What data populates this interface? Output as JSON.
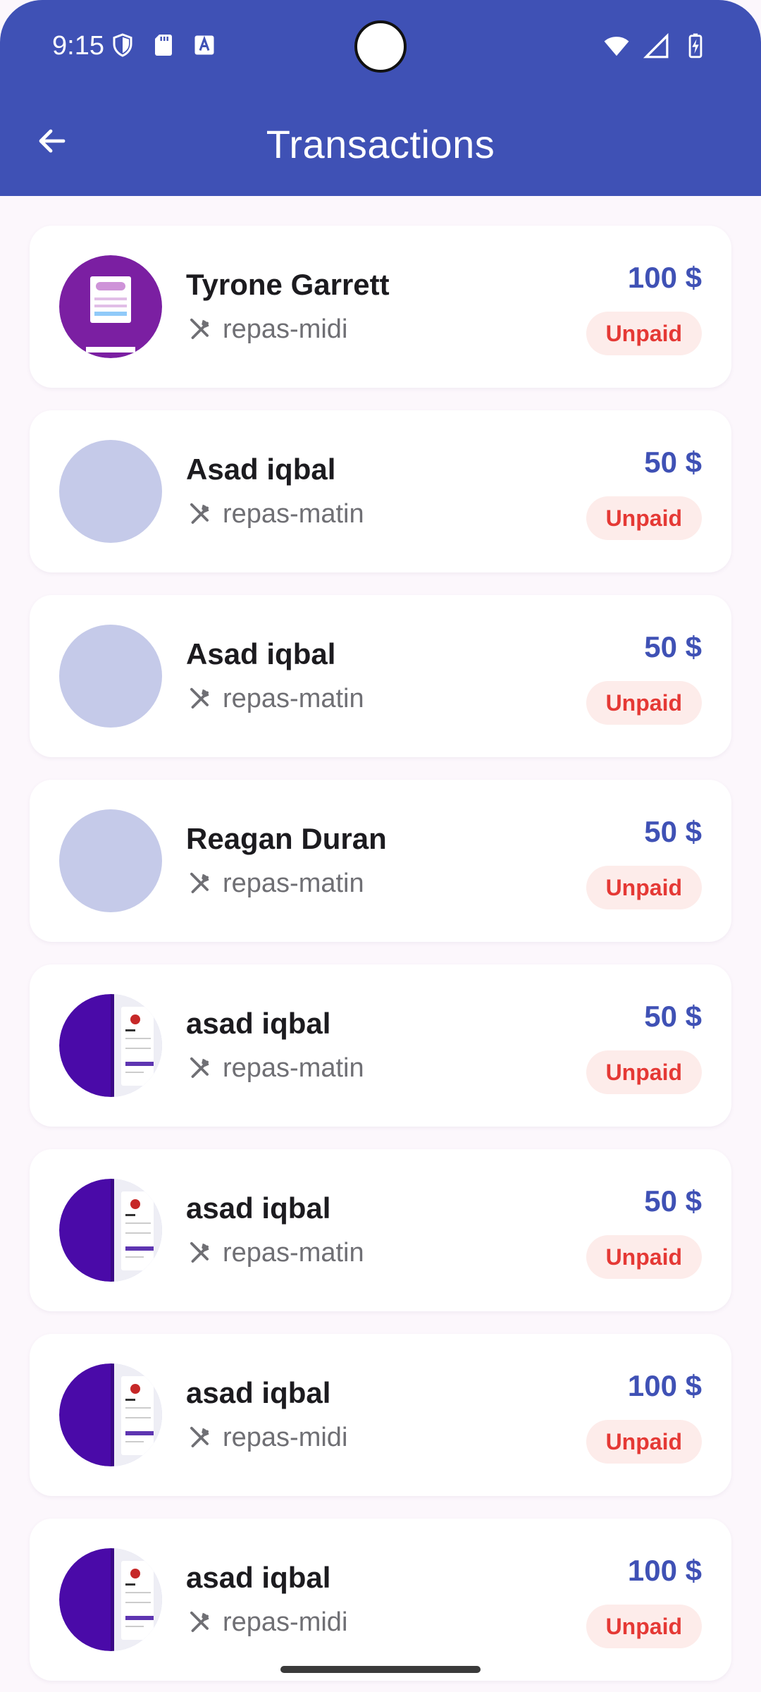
{
  "status_bar": {
    "time": "9:15"
  },
  "header": {
    "title": "Transactions"
  },
  "colors": {
    "primary": "#3f51b5",
    "unpaid_text": "#e53935",
    "unpaid_bg": "#fdecea",
    "avatar_placeholder": "#c5cae9"
  },
  "transactions": [
    {
      "name": "Tyrone Garrett",
      "meal": "repas-midi",
      "amount": "100 $",
      "status": "Unpaid",
      "avatar": "login-screenshot-purple"
    },
    {
      "name": "Asad iqbal",
      "meal": "repas-matin",
      "amount": "50 $",
      "status": "Unpaid",
      "avatar": "placeholder"
    },
    {
      "name": "Asad iqbal",
      "meal": "repas-matin",
      "amount": "50 $",
      "status": "Unpaid",
      "avatar": "placeholder"
    },
    {
      "name": "Reagan Duran",
      "meal": "repas-matin",
      "amount": "50 $",
      "status": "Unpaid",
      "avatar": "placeholder"
    },
    {
      "name": "asad iqbal",
      "meal": "repas-matin",
      "amount": "50 $",
      "status": "Unpaid",
      "avatar": "login-screenshot-split"
    },
    {
      "name": "asad iqbal",
      "meal": "repas-matin",
      "amount": "50 $",
      "status": "Unpaid",
      "avatar": "login-screenshot-split"
    },
    {
      "name": "asad iqbal",
      "meal": "repas-midi",
      "amount": "100 $",
      "status": "Unpaid",
      "avatar": "login-screenshot-split"
    },
    {
      "name": "asad iqbal",
      "meal": "repas-midi",
      "amount": "100 $",
      "status": "Unpaid",
      "avatar": "login-screenshot-split"
    }
  ]
}
